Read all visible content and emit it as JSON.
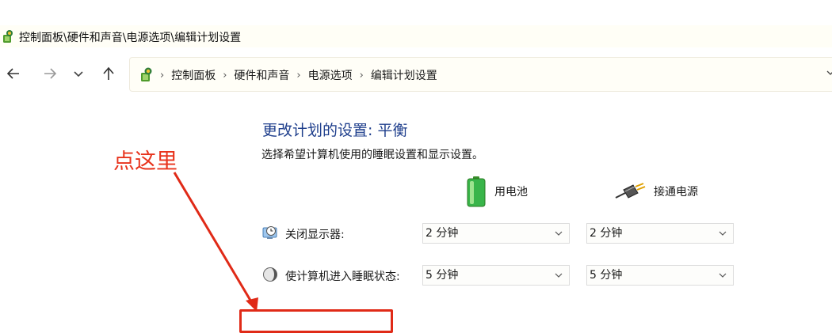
{
  "window": {
    "title": "控制面板\\硬件和声音\\电源选项\\编辑计划设置",
    "icon": "control-panel-icon"
  },
  "nav": {
    "back_icon": "arrow-left-icon",
    "forward_icon": "arrow-right-icon",
    "recent_icon": "chevron-down-icon",
    "up_icon": "arrow-up-icon"
  },
  "address_bar": {
    "breadcrumbs": [
      "控制面板",
      "硬件和声音",
      "电源选项",
      "编辑计划设置"
    ],
    "separator": "›"
  },
  "main": {
    "heading": "更改计划的设置: 平衡",
    "description": "选择希望计算机使用的睡眠设置和显示设置。",
    "columns": {
      "battery": {
        "label": "用电池",
        "icon": "battery-icon"
      },
      "plugged_in": {
        "label": "接通电源",
        "icon": "power-plug-icon"
      }
    },
    "settings": [
      {
        "label": "关闭显示器:",
        "icon": "monitor-clock-icon",
        "battery": "2 分钟",
        "plugged_in": "2 分钟"
      },
      {
        "label": "使计算机进入睡眠状态:",
        "icon": "moon-icon",
        "battery": "5 分钟",
        "plugged_in": "5 分钟"
      }
    ]
  },
  "annotation": {
    "text": "点这里",
    "color": "#e8331c"
  },
  "colors": {
    "heading": "#1e3e8c",
    "titlebar_bg": "#fffef6"
  }
}
